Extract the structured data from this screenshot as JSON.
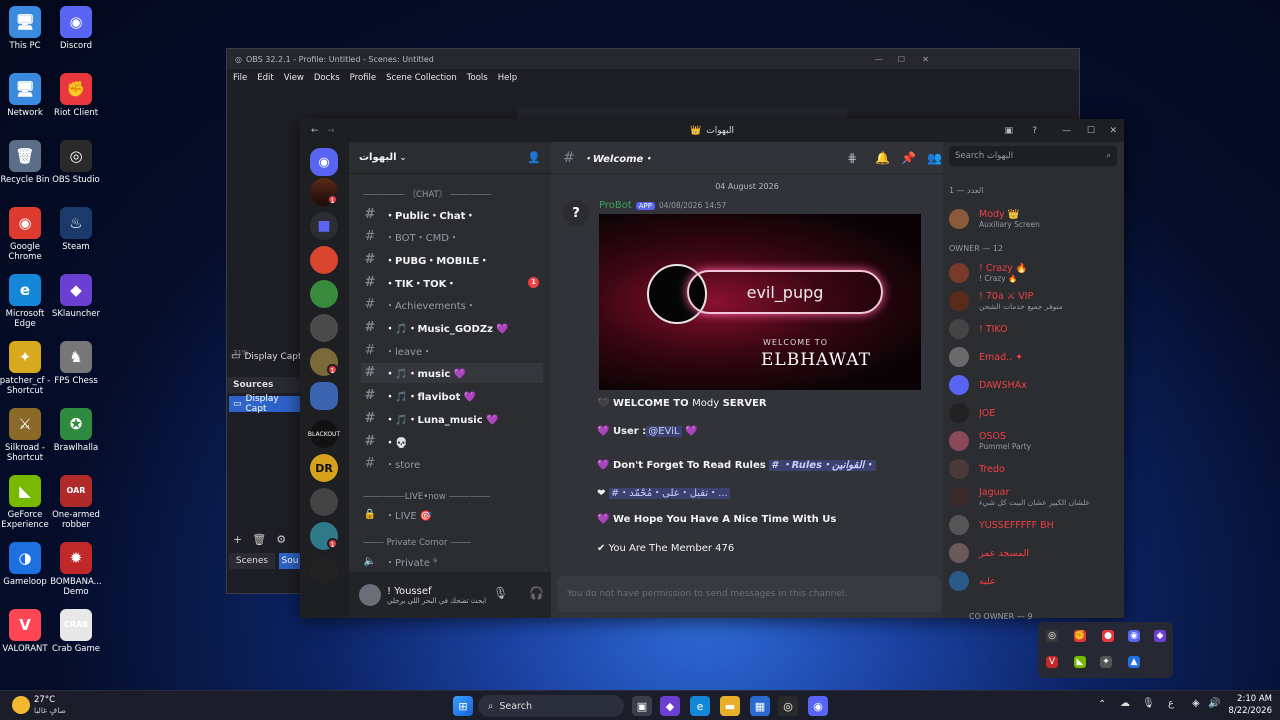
{
  "desktop": {
    "icons": [
      {
        "label": "This PC",
        "glyph": "🖥",
        "color": "#3a8be0"
      },
      {
        "label": "Discord",
        "glyph": "◉",
        "color": "#5865f2"
      },
      {
        "label": "Network",
        "glyph": "🖥",
        "color": "#3a8be0"
      },
      {
        "label": "Riot Client",
        "glyph": "✊",
        "color": "#e8383d"
      },
      {
        "label": "Recycle Bin",
        "glyph": "🗑",
        "color": "#5a6e87"
      },
      {
        "label": "OBS Studio",
        "glyph": "◎",
        "color": "#2a2a2a"
      },
      {
        "label": "Google Chrome",
        "glyph": "◉",
        "color": "#dd3b2f"
      },
      {
        "label": "Steam",
        "glyph": "♨",
        "color": "#1b3a6b"
      },
      {
        "label": "Microsoft Edge",
        "glyph": "e",
        "color": "#1587d8"
      },
      {
        "label": "SKlauncher",
        "glyph": "◆",
        "color": "#6a3fd1"
      },
      {
        "label": "patcher_cf - Shortcut",
        "glyph": "✦",
        "color": "#d8a81e"
      },
      {
        "label": "FPS Chess",
        "glyph": "♞",
        "color": "#777"
      },
      {
        "label": "Silkroad - Shortcut",
        "glyph": "⚔",
        "color": "#8a6a2a"
      },
      {
        "label": "Brawlhalla",
        "glyph": "✪",
        "color": "#2e8a3e"
      },
      {
        "label": "GeForce Experience",
        "glyph": "◣",
        "color": "#76b900"
      },
      {
        "label": "One-armed robber",
        "glyph": "OAR",
        "color": "#b02a2a"
      },
      {
        "label": "Gameloop",
        "glyph": "◑",
        "color": "#1e6fe0"
      },
      {
        "label": "BOMBANA... Demo",
        "glyph": "✹",
        "color": "#c0282a"
      },
      {
        "label": "VALORANT",
        "glyph": "V",
        "color": "#ff4655"
      },
      {
        "label": "Crab Game",
        "glyph": "CRAB",
        "color": "#e8e8e8"
      }
    ]
  },
  "obs": {
    "title": "OBS 32.2.1 - Profile: Untitled - Scenes: Untitled",
    "menu": [
      "File",
      "Edit",
      "View",
      "Docks",
      "Profile",
      "Scene Collection",
      "Tools",
      "Help"
    ],
    "display_capture": "Display Capt",
    "sources_label": "Sources",
    "sources_item": "Display Capt",
    "scenes_tab": "Scenes",
    "sources_tab": "Sou",
    "zoom": "31%"
  },
  "discord": {
    "window_title": "البهوات",
    "server_name": "البهوات",
    "categories": {
      "chat": "⸻⸻ 〘CHAT〙 ⸻⸻",
      "live": "⸻⸻LIVE•now ⸻⸻",
      "private": "⸻ Private Cornor ⸻"
    },
    "channels": [
      {
        "name": "・Public・Chat・",
        "bold": true
      },
      {
        "name": "・BOT・CMD・",
        "bold": false
      },
      {
        "name": "・PUBG・MOBILE・",
        "bold": true
      },
      {
        "name": "・TIK・TOK・",
        "bold": true,
        "badge": "1"
      },
      {
        "name": "・Achievements・",
        "bold": false
      },
      {
        "name": "・🎵・Music_GODZz 💜",
        "bold": true
      },
      {
        "name": "・leave・",
        "bold": false
      },
      {
        "name": "・🎵・music 💜",
        "bold": true
      },
      {
        "name": "・🎵・flavibot 💜",
        "bold": true
      },
      {
        "name": "・🎵・Luna_music 💜",
        "bold": true
      },
      {
        "name": "・💀",
        "bold": true
      },
      {
        "name": "・store",
        "bold": false
      }
    ],
    "voice": [
      {
        "name": "・LIVE 🎯"
      },
      {
        "name": "・Private ⁹"
      }
    ],
    "user": {
      "name": "! Youssef",
      "status": "ابحث تضحك في البحر اللي يرجلي"
    },
    "channel_header": "・Welcome・",
    "search_placeholder": "Search البهوات",
    "date_divider": "04 August 2026",
    "message": {
      "author": "ProBot",
      "tag": "APP",
      "time": "04/08/2026 14:57",
      "banner_name": "evil_pupg",
      "banner_welcome": "WELCOME TO",
      "banner_server": "ELBHAWAT",
      "line1_a": "WELCOME TO",
      "line1_b": "Mody",
      "line1_c": "SERVER",
      "line2_a": "User :",
      "line2_mention": "@EViL",
      "line3_a": "Don't Forget To Read Rules",
      "line3_mention": "# ・Rules・القوانين・",
      "line4_mention": "#・تقبل・على・مُحْمّد・...",
      "line5": "We Hope You Have A Nice Time With Us",
      "line6": "You Are The Member 476"
    },
    "input_placeholder": "You do not have permission to send messages in this channel.",
    "members": {
      "group1": "العدد — 1",
      "group2": "OWNER — 12",
      "group3": "CO OWNER — 9",
      "list": [
        {
          "name": "Mody 👑",
          "sub": "Auxiliary Screen",
          "color": "#f23f43"
        },
        {
          "name": "! Crazy 🔥",
          "sub": "! Crazy 🔥",
          "color": "#f23f43"
        },
        {
          "name": "! 70a ⚔ VIP",
          "sub": "متوفر جميع خدمات الشحن",
          "color": "#f23f43"
        },
        {
          "name": "! TIKO",
          "sub": "",
          "color": "#f23f43"
        },
        {
          "name": "Emad.. ✦",
          "sub": "",
          "color": "#f23f43"
        },
        {
          "name": "DAWSHAx",
          "sub": "",
          "color": "#f23f43"
        },
        {
          "name": "JOE",
          "sub": "",
          "color": "#f23f43"
        },
        {
          "name": "OSOS",
          "sub": "Pummel Party",
          "color": "#f23f43"
        },
        {
          "name": "Tredo",
          "sub": "",
          "color": "#f23f43"
        },
        {
          "name": "Jaguar",
          "sub": "علشان الكبير عشان البيت كل شيء",
          "color": "#f23f43"
        },
        {
          "name": "YUSSEFFFFF BH",
          "sub": "",
          "color": "#f23f43"
        },
        {
          "name": "المسجد عمر",
          "sub": "",
          "color": "#f23f43"
        },
        {
          "name": "عليه",
          "sub": "",
          "color": "#f23f43"
        }
      ]
    }
  },
  "taskbar": {
    "weather_temp": "27°C",
    "weather_desc": "صافٍ غالبا",
    "search": "Search",
    "time": "2:10 AM",
    "date": "8/22/2026"
  }
}
